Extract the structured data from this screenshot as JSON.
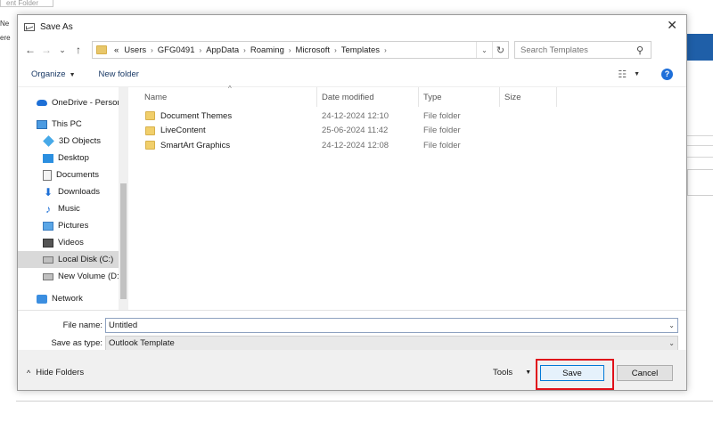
{
  "background": {
    "top_box_text": "ent Folder",
    "left_fragments": [
      "Ne",
      "ere"
    ]
  },
  "dialog": {
    "title": "Save As",
    "close_glyph": "✕"
  },
  "nav": {
    "back": "←",
    "forward": "→",
    "recent": "⌄",
    "up": "↑",
    "overflow": "«",
    "breadcrumb": [
      "Users",
      "GFG0491",
      "AppData",
      "Roaming",
      "Microsoft",
      "Templates"
    ],
    "search_placeholder": "Search Templates"
  },
  "toolbar": {
    "organize": "Organize",
    "new_folder": "New folder"
  },
  "sidebar": {
    "items": [
      {
        "label": "OneDrive - Person",
        "icon": "onedrive-icon"
      },
      {
        "label": "This PC",
        "icon": "computer-icon"
      },
      {
        "label": "3D Objects",
        "icon": "cube-icon"
      },
      {
        "label": "Desktop",
        "icon": "desktop-icon"
      },
      {
        "label": "Documents",
        "icon": "document-icon"
      },
      {
        "label": "Downloads",
        "icon": "download-icon"
      },
      {
        "label": "Music",
        "icon": "music-icon"
      },
      {
        "label": "Pictures",
        "icon": "pictures-icon"
      },
      {
        "label": "Videos",
        "icon": "video-icon"
      },
      {
        "label": "Local Disk (C:)",
        "icon": "disk-icon",
        "selected": true
      },
      {
        "label": "New Volume (D:",
        "icon": "disk-icon"
      },
      {
        "label": "Network",
        "icon": "network-icon"
      }
    ]
  },
  "files": {
    "columns": [
      "Name",
      "Date modified",
      "Type",
      "Size"
    ],
    "rows": [
      {
        "name": "Document Themes",
        "date": "24-12-2024 12:10",
        "type": "File folder"
      },
      {
        "name": "LiveContent",
        "date": "25-06-2024 11:42",
        "type": "File folder"
      },
      {
        "name": "SmartArt Graphics",
        "date": "24-12-2024 12:08",
        "type": "File folder"
      }
    ]
  },
  "form": {
    "filename_label": "File name:",
    "filename_value": "Untitled",
    "savetype_label": "Save as type:",
    "savetype_value": "Outlook Template"
  },
  "footer": {
    "hide_folders": "Hide Folders",
    "tools": "Tools",
    "save": "Save",
    "cancel": "Cancel"
  },
  "colors": {
    "accent": "#0078d7",
    "highlight": "#e0101a",
    "folder": "#f1cf6b"
  }
}
